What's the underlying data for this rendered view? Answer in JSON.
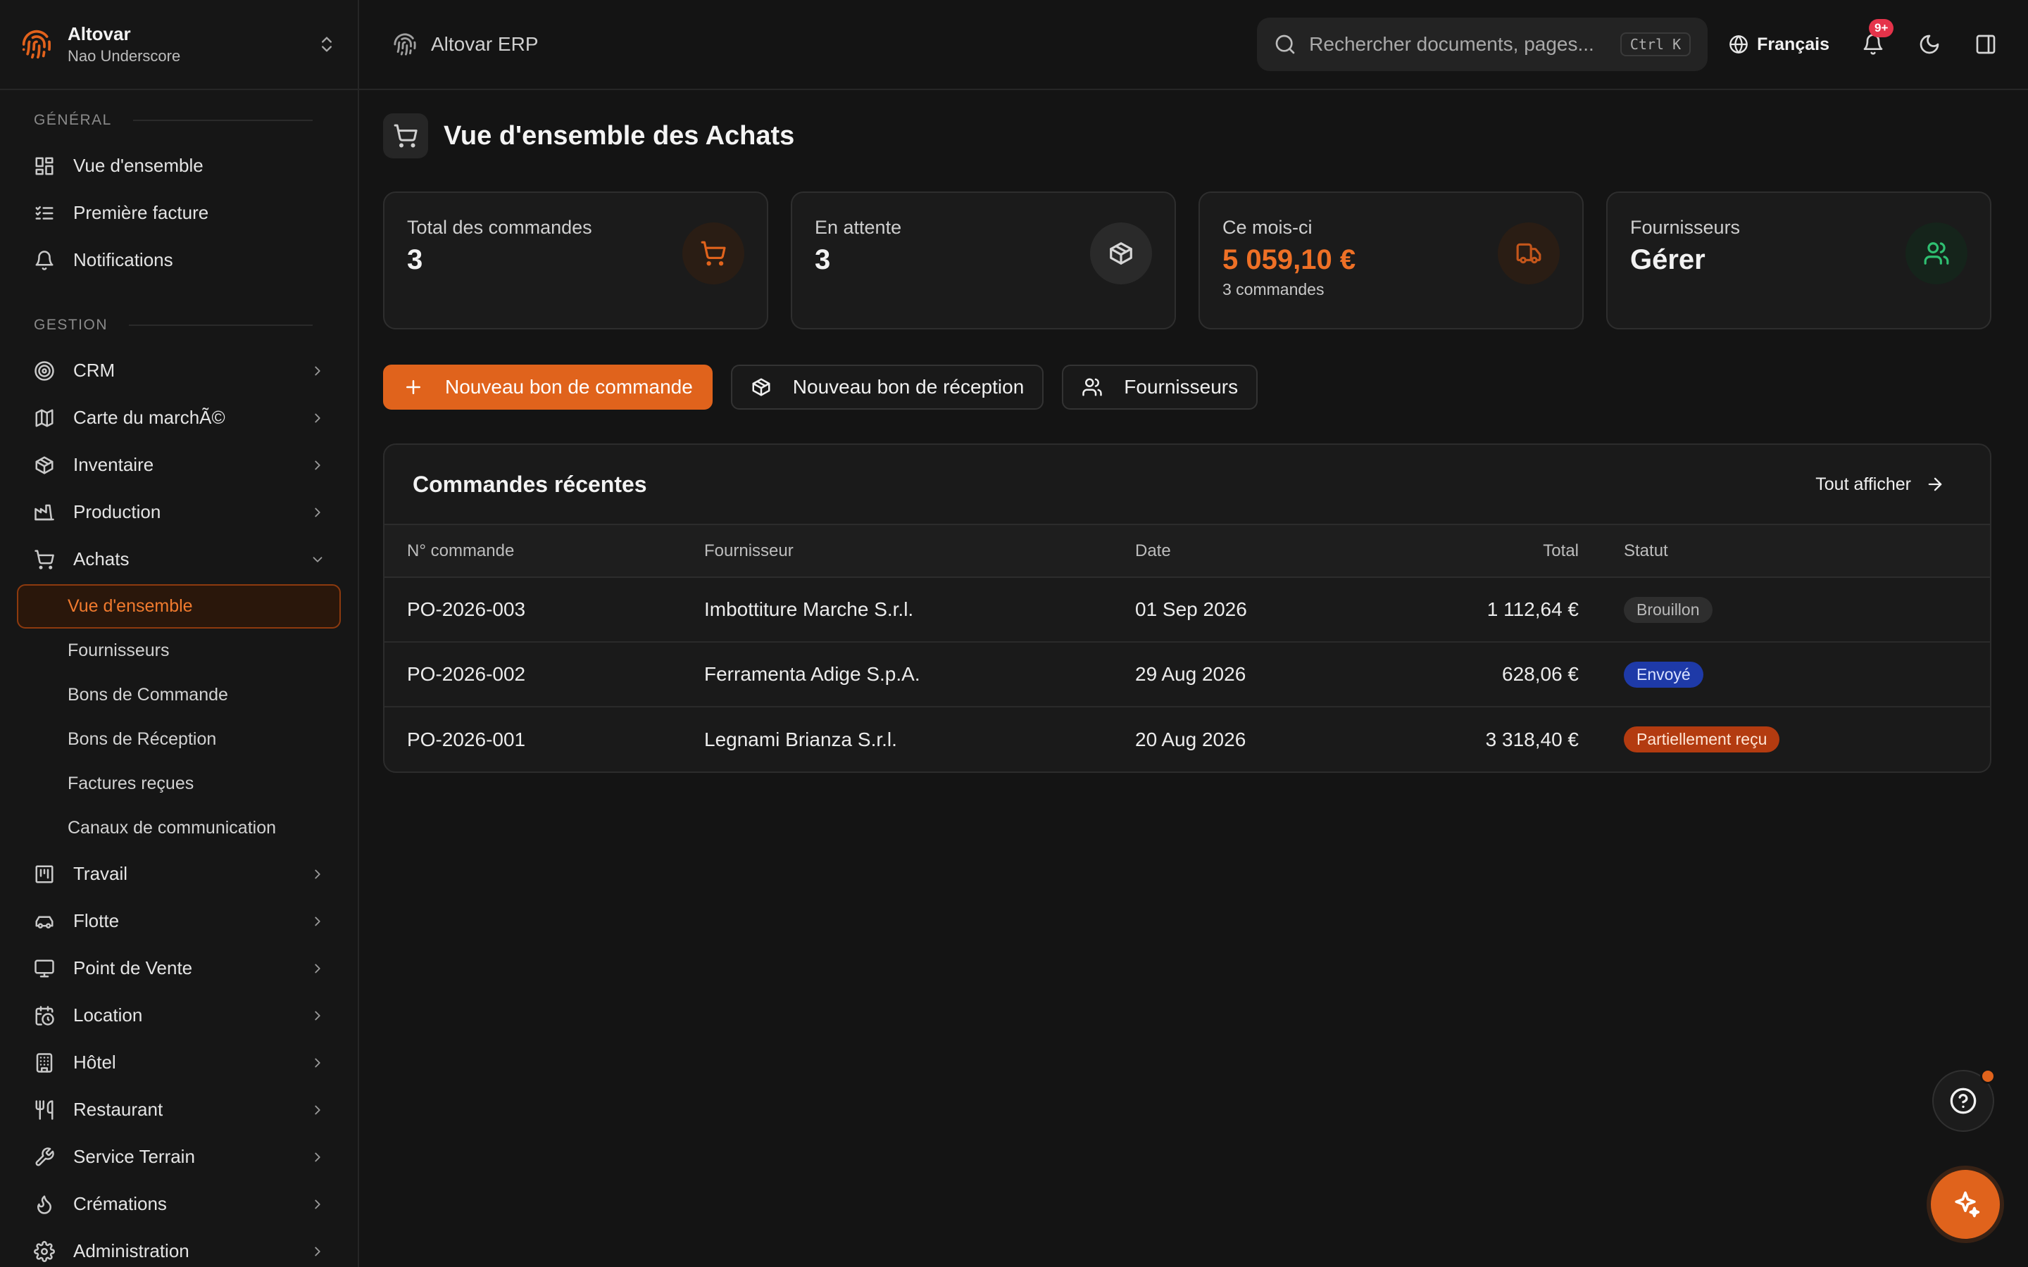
{
  "org": {
    "name": "Altovar",
    "user": "Nao Underscore"
  },
  "topbar": {
    "app_name": "Altovar ERP",
    "search_placeholder": "Rechercher documents, pages...",
    "search_shortcut": "Ctrl K",
    "language": "Français",
    "notifications_badge": "9+"
  },
  "sidebar": {
    "general_label": "GÉNÉRAL",
    "general_items": [
      {
        "label": "Vue d'ensemble",
        "icon": "dashboard-icon"
      },
      {
        "label": "Première facture",
        "icon": "checklist-icon"
      },
      {
        "label": "Notifications",
        "icon": "bell-icon"
      }
    ],
    "gestion_label": "GESTION",
    "gestion_items": [
      {
        "label": "CRM",
        "icon": "target-icon"
      },
      {
        "label": "Carte du marchÃ©",
        "icon": "map-icon"
      },
      {
        "label": "Inventaire",
        "icon": "package-icon"
      },
      {
        "label": "Production",
        "icon": "factory-icon"
      },
      {
        "label": "Achats",
        "icon": "cart-icon",
        "expanded": true
      }
    ],
    "achats_sub": [
      {
        "label": "Vue d'ensemble",
        "active": true
      },
      {
        "label": "Fournisseurs"
      },
      {
        "label": "Bons de Commande"
      },
      {
        "label": "Bons de Réception"
      },
      {
        "label": "Factures reçues"
      },
      {
        "label": "Canaux de communication"
      }
    ],
    "more_items": [
      {
        "label": "Travail",
        "icon": "kanban-icon"
      },
      {
        "label": "Flotte",
        "icon": "car-icon"
      },
      {
        "label": "Point de Vente",
        "icon": "monitor-icon"
      },
      {
        "label": "Location",
        "icon": "calendar-clock-icon"
      },
      {
        "label": "Hôtel",
        "icon": "building-icon"
      },
      {
        "label": "Restaurant",
        "icon": "utensils-icon"
      },
      {
        "label": "Service Terrain",
        "icon": "wrench-icon"
      },
      {
        "label": "Crémations",
        "icon": "flame-icon"
      },
      {
        "label": "Administration",
        "icon": "gear-icon"
      }
    ]
  },
  "page": {
    "title": "Vue d'ensemble des Achats"
  },
  "stats": [
    {
      "label": "Total des commandes",
      "value": "3",
      "sub": "",
      "icon": "cart-icon",
      "icon_color": "#e0631c",
      "icon_bg": "#2a1d14"
    },
    {
      "label": "En attente",
      "value": "3",
      "sub": "",
      "icon": "package-icon",
      "icon_color": "#d6d6d6",
      "icon_bg": "#2a2a2a"
    },
    {
      "label": "Ce mois-ci",
      "value": "5 059,10 €",
      "sub": "3 commandes",
      "icon": "truck-icon",
      "icon_color": "#c4561b",
      "icon_bg": "#2a1d14"
    },
    {
      "label": "Fournisseurs",
      "value": "Gérer",
      "sub": "",
      "icon": "users-icon",
      "icon_color": "#2fbf71",
      "icon_bg": "#15241b"
    }
  ],
  "actions": {
    "new_order": "Nouveau bon de commande",
    "new_receipt": "Nouveau bon de réception",
    "suppliers": "Fournisseurs"
  },
  "recent": {
    "title": "Commandes récentes",
    "view_all": "Tout afficher",
    "columns": [
      "N° commande",
      "Fournisseur",
      "Date",
      "Total",
      "Statut"
    ],
    "rows": [
      {
        "number": "PO-2026-003",
        "supplier": "Imbottiture Marche S.r.l.",
        "date": "01 Sep 2026",
        "total": "1 112,64 €",
        "status": "Brouillon",
        "status_kind": "draft"
      },
      {
        "number": "PO-2026-002",
        "supplier": "Ferramenta Adige S.p.A.",
        "date": "29 Aug 2026",
        "total": "628,06 €",
        "status": "Envoyé",
        "status_kind": "sent"
      },
      {
        "number": "PO-2026-001",
        "supplier": "Legnami Brianza S.r.l.",
        "date": "20 Aug 2026",
        "total": "3 318,40 €",
        "status": "Partiellement reçu",
        "status_kind": "partial"
      }
    ]
  }
}
